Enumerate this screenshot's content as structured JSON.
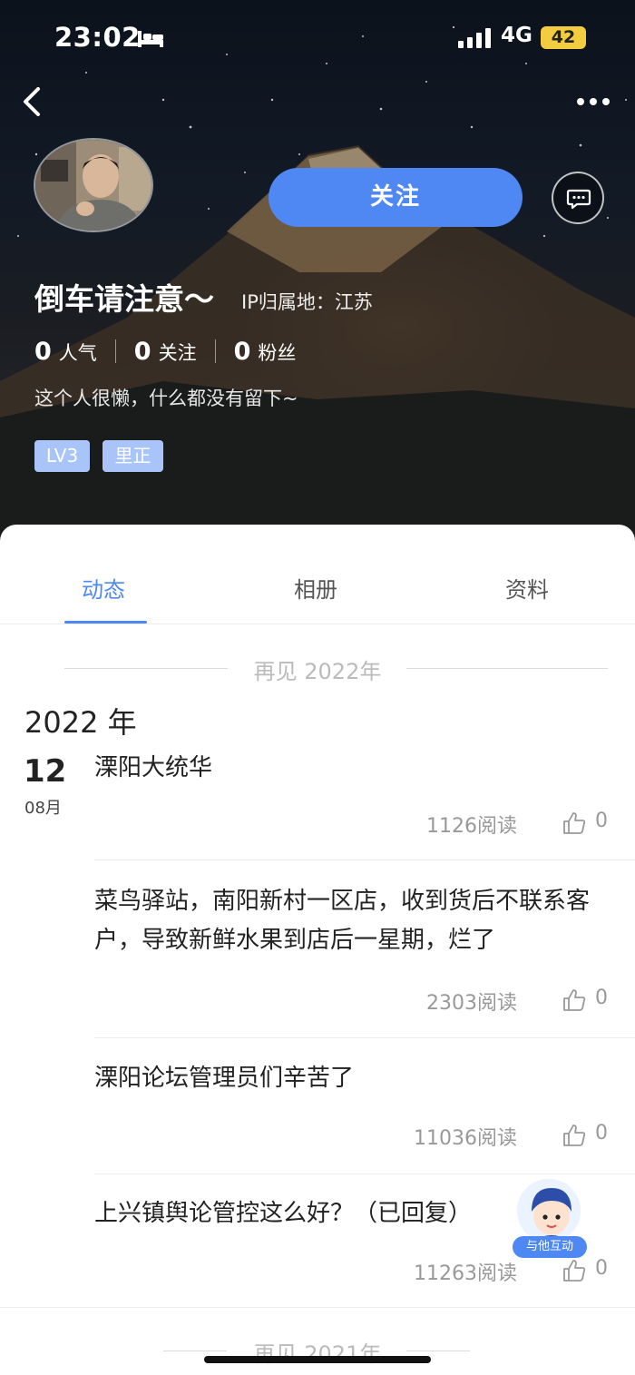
{
  "status_bar": {
    "time": "23:02",
    "network": "4G",
    "battery": "42"
  },
  "profile": {
    "follow_label": "关注",
    "username": "倒车请注意～",
    "ip_location": "IP归属地：江苏",
    "stats": [
      {
        "value": "0",
        "label": "人气"
      },
      {
        "value": "0",
        "label": "关注"
      },
      {
        "value": "0",
        "label": "粉丝"
      }
    ],
    "bio": "这个人很懒，什么都没有留下~",
    "badges": [
      "LV3",
      "里正"
    ]
  },
  "tabs": [
    {
      "label": "动态",
      "active": true
    },
    {
      "label": "相册",
      "active": false
    },
    {
      "label": "资料",
      "active": false
    }
  ],
  "feed": {
    "divider_top": "再见 2022年",
    "year": "2022 年",
    "date_day": "12",
    "date_month": "08月",
    "posts": [
      {
        "title": "溧阳大统华",
        "reads": "1126阅读",
        "likes": "0"
      },
      {
        "title": "菜鸟驿站，南阳新村一区店，收到货后不联系客户，导致新鲜水果到店后一星期，烂了",
        "reads": "2303阅读",
        "likes": "0"
      },
      {
        "title": "溧阳论坛管理员们辛苦了",
        "reads": "11036阅读",
        "likes": "0"
      },
      {
        "title": "上兴镇舆论管控这么好？（已回复）",
        "reads": "11263阅读",
        "likes": "0"
      }
    ],
    "divider_bottom": "再见 2021年"
  },
  "float_button": {
    "label": "与他互动"
  },
  "colors": {
    "accent": "#4f88f2",
    "badge": "#a8c4f8",
    "battery": "#f3cd3f"
  }
}
